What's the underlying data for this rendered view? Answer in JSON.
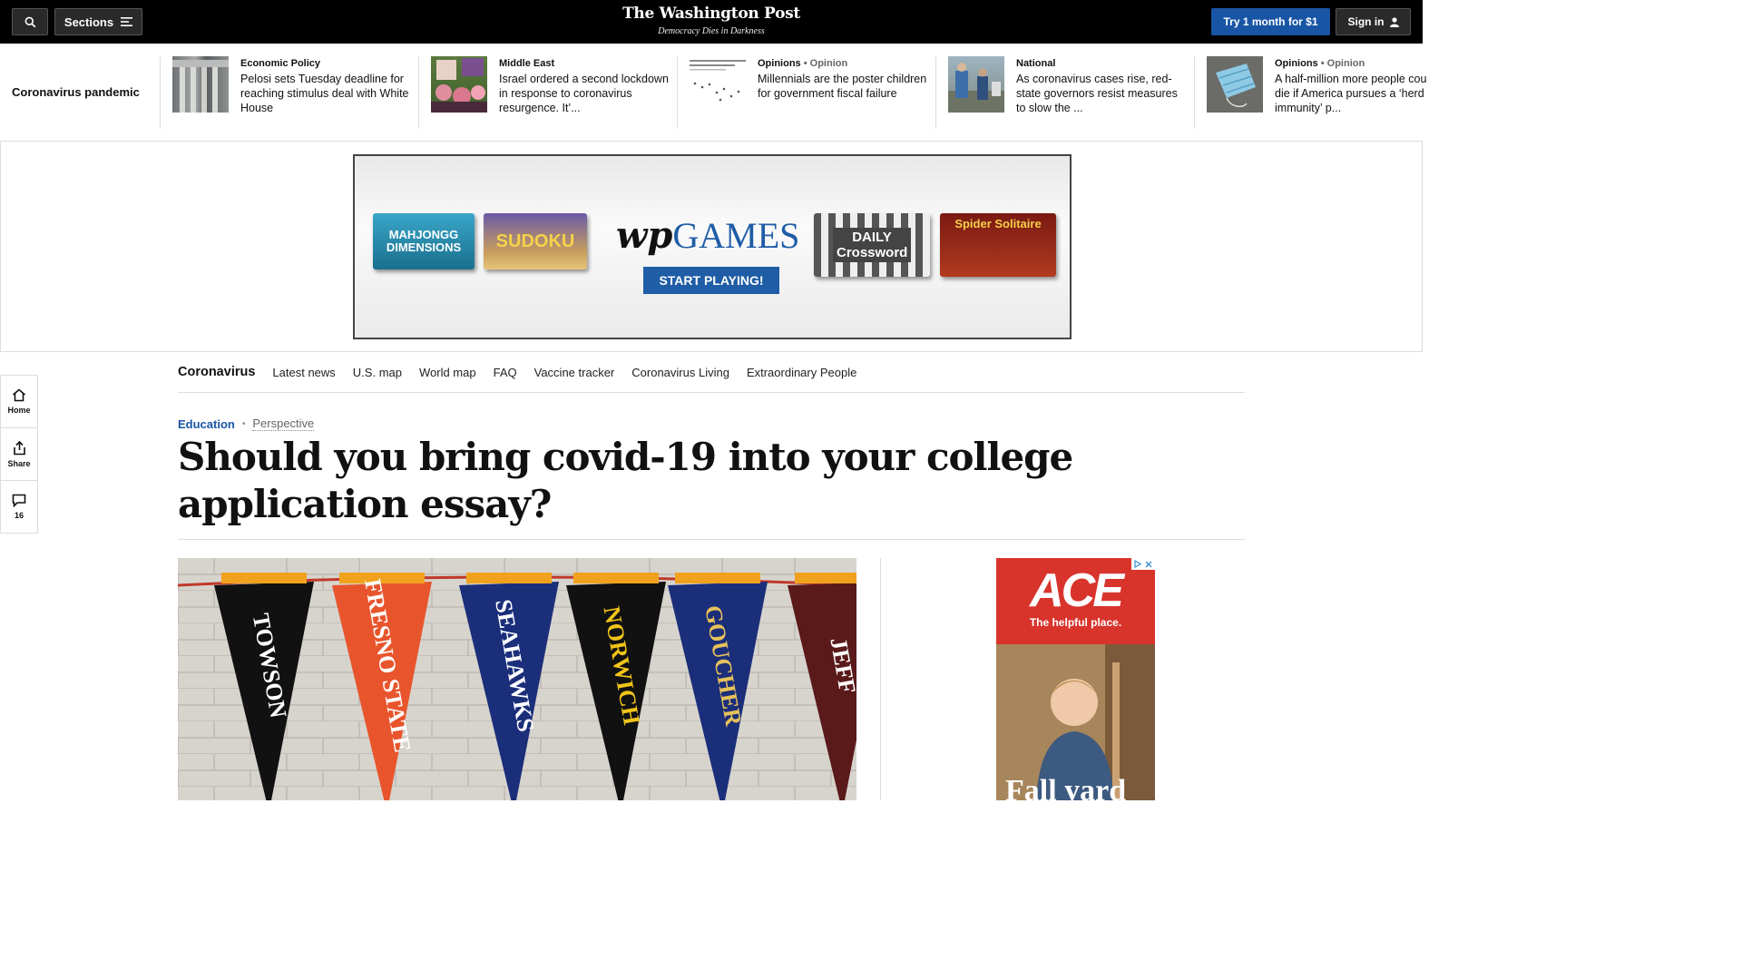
{
  "header": {
    "sections_label": "Sections",
    "logo": "The Washington Post",
    "tagline": "Democracy Dies in Darkness",
    "try_label": "Try 1 month for $1",
    "signin_label": "Sign in"
  },
  "trending": {
    "label": "Coronavirus pandemic",
    "stories": [
      {
        "kicker": "Economic Policy",
        "sub": "",
        "headline": "Pelosi sets Tuesday deadline for reaching stimulus deal with White House"
      },
      {
        "kicker": "Middle East",
        "sub": "",
        "headline": "Israel ordered a second lockdown in response to coronavirus resurgence. It’..."
      },
      {
        "kicker": "Opinions",
        "sub": "• Opinion",
        "headline": "Millennials are the poster children for government fiscal failure"
      },
      {
        "kicker": "National",
        "sub": "",
        "headline": "As coronavirus cases rise, red-state governors resist measures to slow the ..."
      },
      {
        "kicker": "Opinions",
        "sub": "• Opinion",
        "headline": "A half-million more people cou die if America pursues a ‘herd immunity’ p..."
      }
    ]
  },
  "ad": {
    "tiles": [
      "MAHJONGG DIMENSIONS",
      "SUDOKU",
      "DAILY Crossword",
      "Spider Solitaire"
    ],
    "wp": "wp",
    "games": "GAMES",
    "cta": "START PLAYING!"
  },
  "section_nav": {
    "title": "Coronavirus",
    "links": [
      "Latest news",
      "U.S. map",
      "World map",
      "FAQ",
      "Vaccine tracker",
      "Coronavirus Living",
      "Extraordinary People"
    ]
  },
  "rail": {
    "home": "Home",
    "share": "Share",
    "comments": "16"
  },
  "article": {
    "section": "Education",
    "label": "Perspective",
    "headline": "Should you bring covid-19 into your college application essay?"
  },
  "photo": {
    "pennants": [
      "TOWSON",
      "FRESNO STATE",
      "SEAHAWKS",
      "NORWICH",
      "GOUCHER",
      "JEFF"
    ],
    "pennant_colors": [
      "#111111",
      "#e8552d",
      "#1b2e7a",
      "#111111",
      "#1b2e7a",
      "#5a1a1a"
    ]
  },
  "side_ad": {
    "brand": "ACE",
    "tagline": "The helpful place.",
    "headline": "Fall yard"
  },
  "colors": {
    "accent": "#1955a5",
    "topbar": "#000000"
  }
}
